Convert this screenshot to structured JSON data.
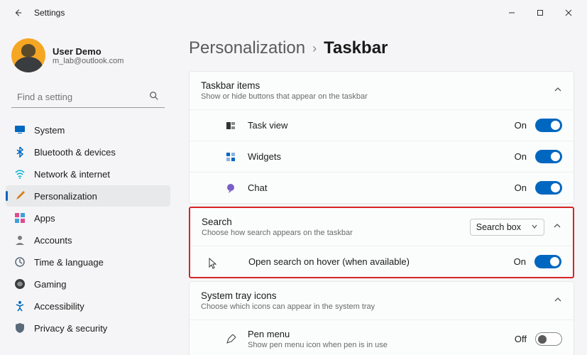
{
  "titlebar": {
    "title": "Settings"
  },
  "profile": {
    "name": "User Demo",
    "email": "m_lab@outlook.com"
  },
  "search": {
    "placeholder": "Find a setting"
  },
  "nav": {
    "system": "System",
    "bluetooth": "Bluetooth & devices",
    "network": "Network & internet",
    "personalization": "Personalization",
    "apps": "Apps",
    "accounts": "Accounts",
    "time": "Time & language",
    "gaming": "Gaming",
    "accessibility": "Accessibility",
    "privacy": "Privacy & security"
  },
  "breadcrumb": {
    "parent": "Personalization",
    "current": "Taskbar"
  },
  "taskbar_items": {
    "title": "Taskbar items",
    "sub": "Show or hide buttons that appear on the taskbar",
    "taskview": {
      "label": "Task view",
      "state": "On"
    },
    "widgets": {
      "label": "Widgets",
      "state": "On"
    },
    "chat": {
      "label": "Chat",
      "state": "On"
    }
  },
  "search_section": {
    "title": "Search",
    "sub": "Choose how search appears on the taskbar",
    "select": "Search box",
    "hover": {
      "label": "Open search on hover (when available)",
      "state": "On"
    }
  },
  "tray": {
    "title": "System tray icons",
    "sub": "Choose which icons can appear in the system tray",
    "pen": {
      "label": "Pen menu",
      "sub": "Show pen menu icon when pen is in use",
      "state": "Off"
    }
  }
}
